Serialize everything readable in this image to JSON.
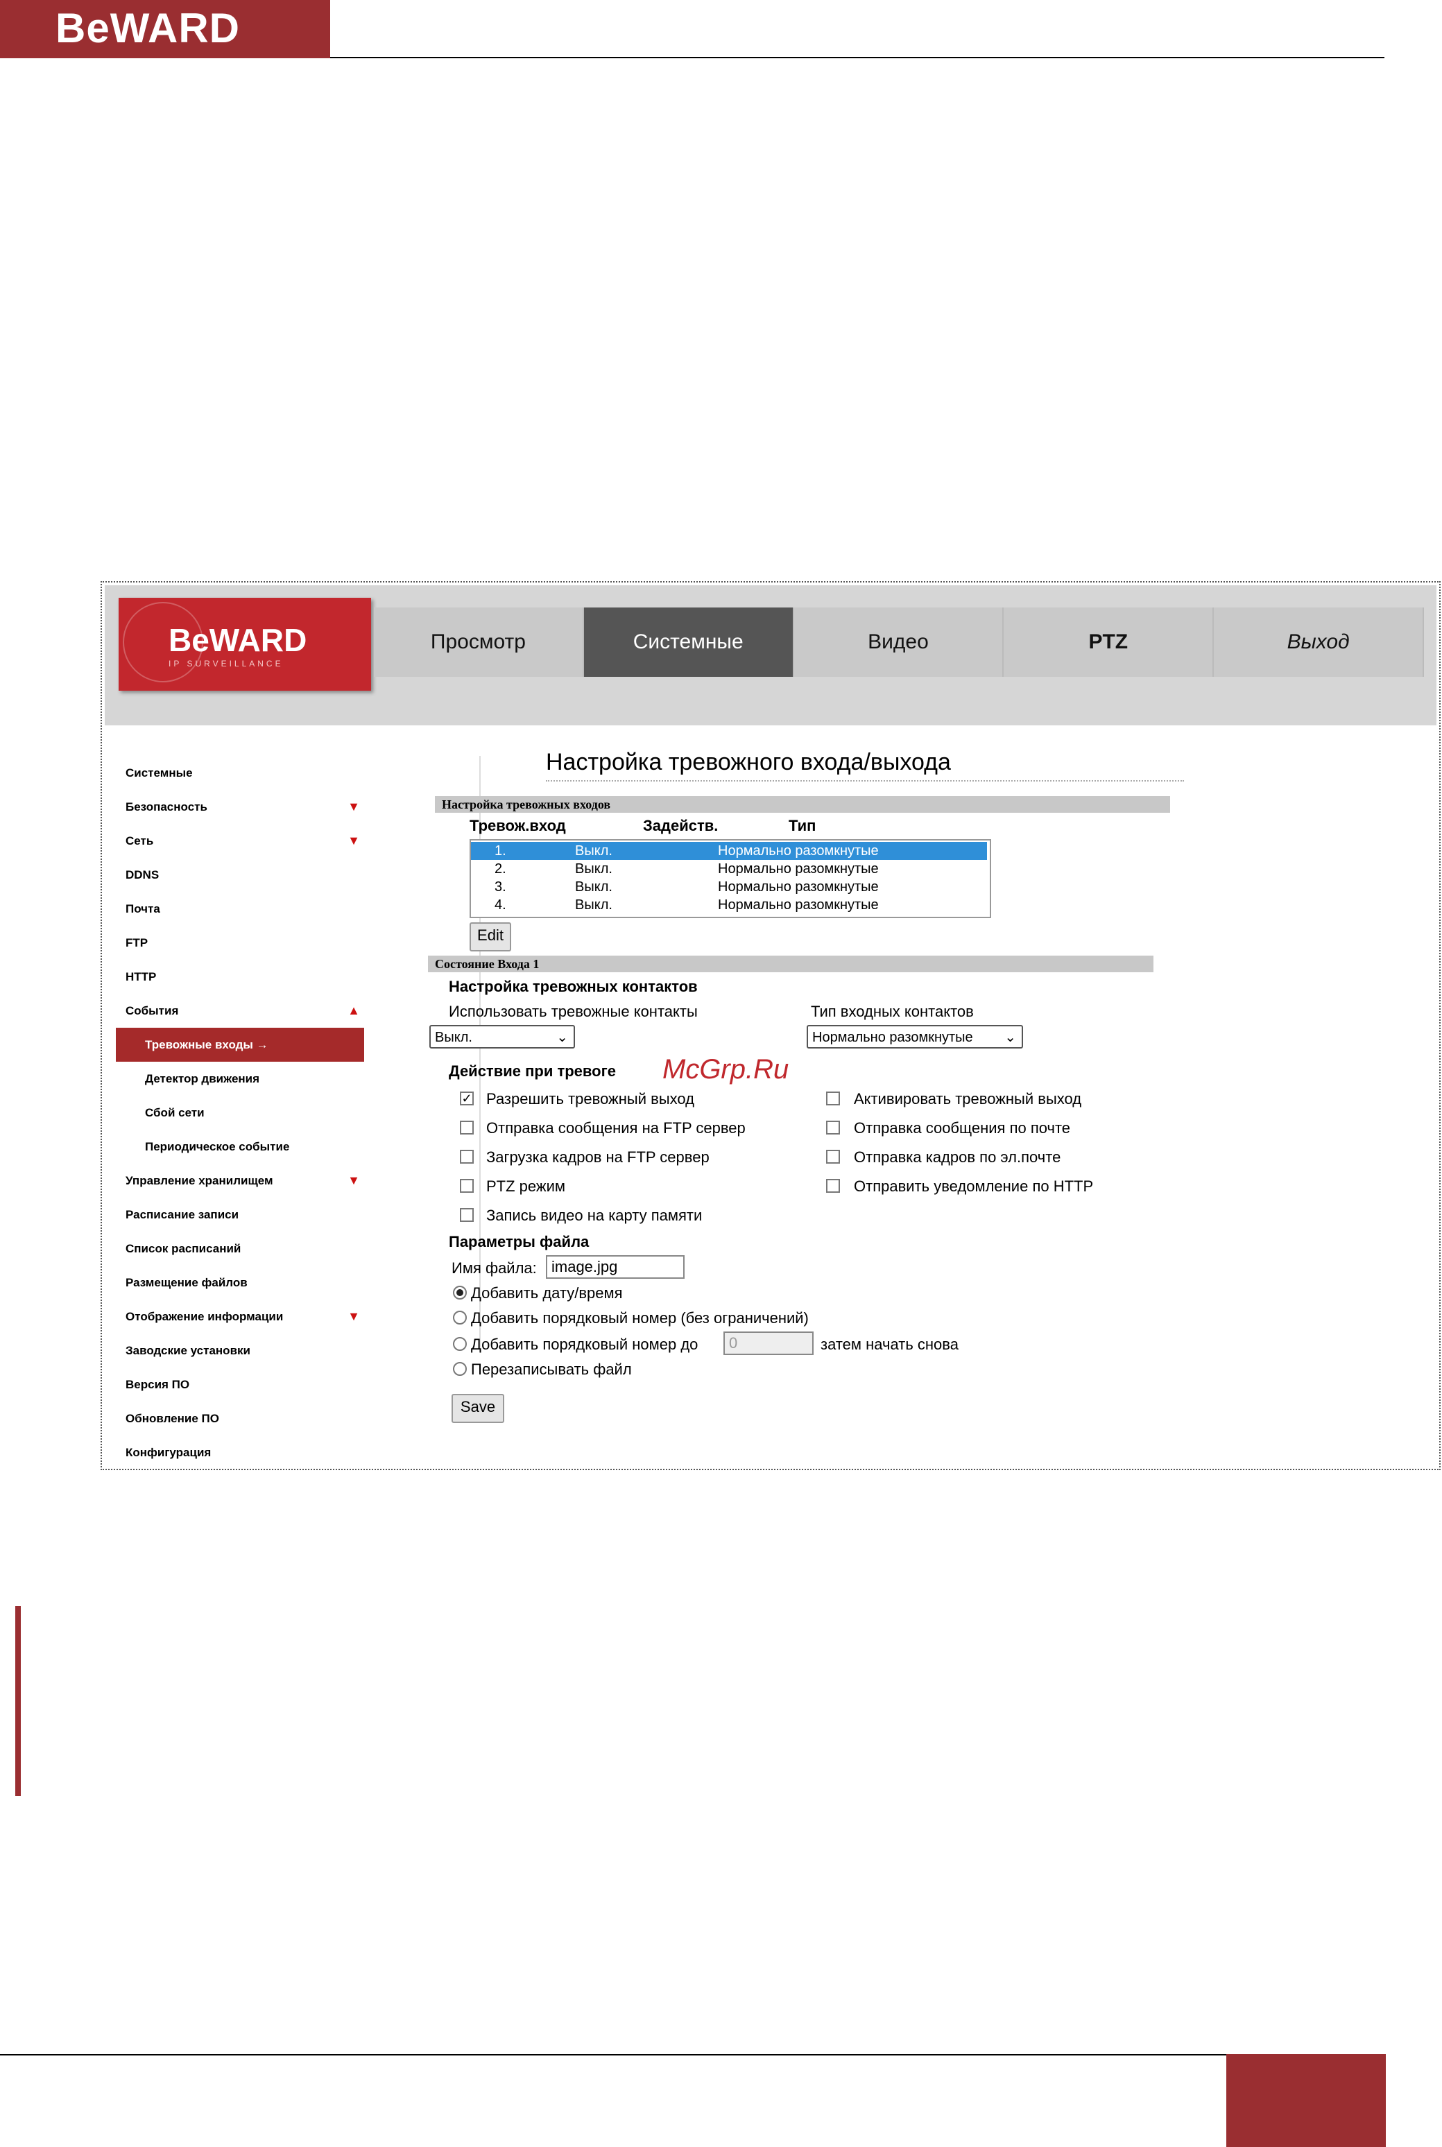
{
  "page_header": {
    "logo": "BeWARD"
  },
  "banner": {
    "logo_brand": "BeWARD",
    "logo_tagline": "IP SURVEILLANCE"
  },
  "nav": [
    "Просмотр",
    "Системные",
    "Видео",
    "PTZ",
    "Выход"
  ],
  "sidebar": [
    {
      "label": "Системные",
      "arrow": ""
    },
    {
      "label": "Безопасность",
      "arrow": "▼"
    },
    {
      "label": "Сеть",
      "arrow": "▼"
    },
    {
      "label": "DDNS",
      "arrow": ""
    },
    {
      "label": "Почта",
      "arrow": ""
    },
    {
      "label": "FTP",
      "arrow": ""
    },
    {
      "label": "HTTP",
      "arrow": ""
    },
    {
      "label": "События",
      "arrow": "▲"
    },
    {
      "label": "Тревожные входы →",
      "arrow": "",
      "sub": true,
      "active": true
    },
    {
      "label": "Детектор движения",
      "arrow": "",
      "sub": true
    },
    {
      "label": "Сбой сети",
      "arrow": "",
      "sub": true
    },
    {
      "label": "Периодическое событие",
      "arrow": "",
      "sub": true
    },
    {
      "label": "Управление хранилищем",
      "arrow": "▼"
    },
    {
      "label": "Расписание записи",
      "arrow": ""
    },
    {
      "label": "Список расписаний",
      "arrow": ""
    },
    {
      "label": "Размещение файлов",
      "arrow": ""
    },
    {
      "label": "Отображение информации",
      "arrow": "▼"
    },
    {
      "label": "Заводские установки",
      "arrow": ""
    },
    {
      "label": "Версия ПО",
      "arrow": ""
    },
    {
      "label": "Обновление ПО",
      "arrow": ""
    },
    {
      "label": "Конфигурация",
      "arrow": ""
    }
  ],
  "content": {
    "title": "Настройка тревожного входа/выхода",
    "section_inputs": "Настройка тревожных входов",
    "columns": [
      "Тревож.вход",
      "Задейств.",
      "Тип"
    ],
    "rows": [
      {
        "n": "1.",
        "state": "Выкл.",
        "type": "Нормально разомкнутые"
      },
      {
        "n": "2.",
        "state": "Выкл.",
        "type": "Нормально разомкнутые"
      },
      {
        "n": "3.",
        "state": "Выкл.",
        "type": "Нормально разомкнутые"
      },
      {
        "n": "4.",
        "state": "Выкл.",
        "type": "Нормально разомкнутые"
      }
    ],
    "edit_label": "Edit",
    "section_state": "Состояние Входа 1",
    "contacts_heading": "Настройка тревожных контактов",
    "use_contacts_label": "Использовать тревожные контакты",
    "use_contacts_value": "Выкл.",
    "contact_type_label": "Тип входных контактов",
    "contact_type_value": "Нормально разомкнутые",
    "action_heading": "Действие при тревоге",
    "actions_left": [
      {
        "label": "Разрешить тревожный выход",
        "checked": true
      },
      {
        "label": "Отправка сообщения на FTP сервер",
        "checked": false
      },
      {
        "label": "Загрузка кадров на FTP сервер",
        "checked": false
      },
      {
        "label": "PTZ режим",
        "checked": false
      },
      {
        "label": "Запись видео на карту памяти",
        "checked": false
      }
    ],
    "actions_right": [
      {
        "label": "Активировать тревожный выход",
        "checked": false
      },
      {
        "label": "Отправка сообщения по почте",
        "checked": false
      },
      {
        "label": "Отправка кадров по эл.почте",
        "checked": false
      },
      {
        "label": "Отправить уведомление по HTTP",
        "checked": false
      }
    ],
    "file_heading": "Параметры файла",
    "file_name_label": "Имя файла:",
    "file_name_value": "image.jpg",
    "radios": [
      {
        "label": "Добавить дату/время",
        "checked": true
      },
      {
        "label": "Добавить порядковый номер (без ограничений)",
        "checked": false
      },
      {
        "label": "Добавить порядковый номер до",
        "checked": false
      },
      {
        "label": "Перезаписывать файл",
        "checked": false
      }
    ],
    "counter_value": "0",
    "counter_suffix": "затем начать снова",
    "save_label": "Save"
  },
  "watermark": "McGrp.Ru",
  "colors": {
    "brand": "#9a2e31",
    "logo_red": "#c2272d",
    "active_tab": "#555555",
    "selected_row": "#2f8fd8"
  }
}
